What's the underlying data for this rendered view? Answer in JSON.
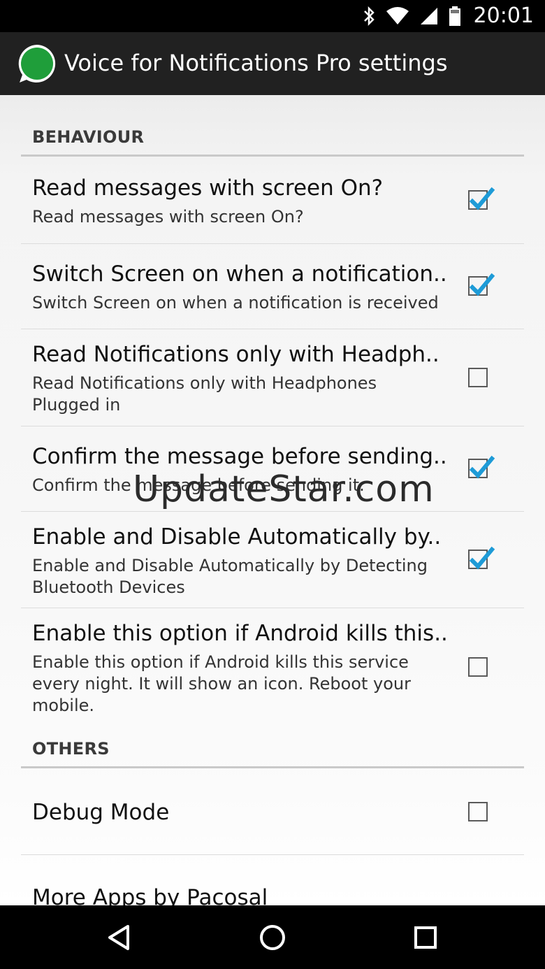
{
  "status_bar": {
    "time": "20:01",
    "icons": [
      "bluetooth-icon",
      "wifi-icon",
      "signal-icon",
      "battery-icon"
    ]
  },
  "action_bar": {
    "title": "Voice for Notifications Pro settings",
    "logo_text": "Voice for Notifications PRO"
  },
  "sections": [
    {
      "header": "BEHAVIOUR",
      "items": [
        {
          "title": "Read messages with screen On?",
          "summary": "Read messages with screen On?",
          "checked": true
        },
        {
          "title": "Switch Screen on when a notification..",
          "summary": "Switch Screen on when a notification is received",
          "checked": true
        },
        {
          "title": "Read Notifications only with Headph..",
          "summary": "Read Notifications only with Headphones Plugged in",
          "checked": false
        },
        {
          "title": "Confirm the message before sending..",
          "summary": "Confirm the message before sending it.",
          "checked": true
        },
        {
          "title": "Enable and Disable Automatically by..",
          "summary": "Enable and Disable Automatically by Detecting Bluetooth Devices",
          "checked": true
        },
        {
          "title": "Enable this option if Android kills this..",
          "summary": "Enable this option if Android kills this service every night. It will show an icon. Reboot your mobile.",
          "checked": false
        }
      ]
    },
    {
      "header": "OTHERS",
      "items": [
        {
          "title": "Debug Mode",
          "checked": false
        },
        {
          "title": "More Apps by Pacosal"
        }
      ]
    }
  ],
  "watermark": "UpdateStar.com",
  "colors": {
    "action_bar": "#212121",
    "check_accent": "#1e9bd7",
    "status_bar": "#000000"
  }
}
